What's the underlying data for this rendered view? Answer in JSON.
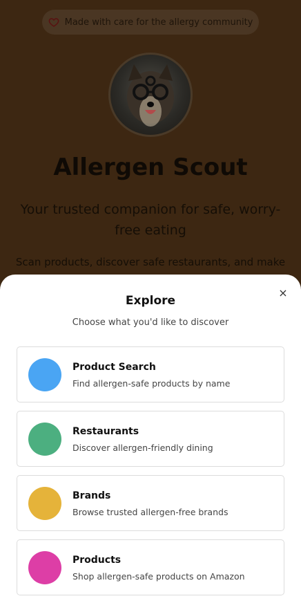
{
  "landing": {
    "pill_text": "Made with care for the allergy community",
    "app_title": "Allergen Scout",
    "tagline": "Your trusted companion for safe, worry-free eating",
    "description": "Scan products, discover safe restaurants, and make"
  },
  "sheet": {
    "title": "Explore",
    "subtitle": "Choose what you'd like to discover",
    "close_icon": "×"
  },
  "options": [
    {
      "title": "Product Search",
      "description": "Find allergen-safe products by name",
      "color": "#4aa5f3"
    },
    {
      "title": "Restaurants",
      "description": "Discover allergen-friendly dining",
      "color": "#4caf80"
    },
    {
      "title": "Brands",
      "description": "Browse trusted allergen-free brands",
      "color": "#e5b33a"
    },
    {
      "title": "Products",
      "description": "Shop allergen-safe products on Amazon",
      "color": "#dd3ea6"
    }
  ]
}
